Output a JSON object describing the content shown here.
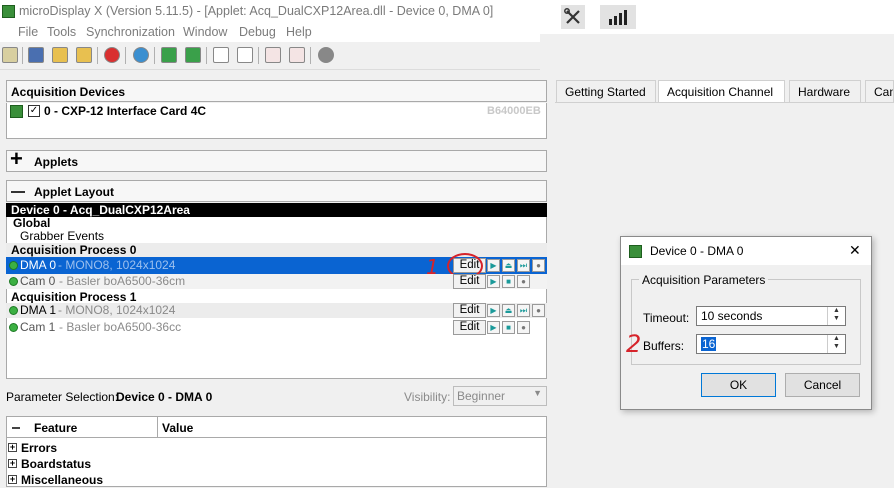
{
  "window": {
    "title": "microDisplay X (Version 5.11.5) - [Applet: Acq_DualCXP12Area.dll - Device 0, DMA 0]"
  },
  "menu": [
    "File",
    "Tools",
    "Synchronization",
    "Window",
    "Debug",
    "Help"
  ],
  "acquisition_devices": {
    "header": "Acquisition Devices",
    "device": "0 - CXP-12 Interface Card 4C",
    "serial": "B64000EB"
  },
  "applets": {
    "header": "Applets"
  },
  "applet_layout": {
    "header": "Applet Layout",
    "device_title": "Device 0 - Acq_DualCXP12Area",
    "global_label": "Global",
    "grabber_events": "Grabber Events",
    "processes": [
      {
        "label": "Acquisition Process 0",
        "dma": {
          "name": "DMA 0",
          "info": " - MONO8, 1024x1024",
          "edit": "Edit"
        },
        "cam": {
          "name": "Cam 0",
          "info": " - Basler boA6500-36cm",
          "edit": "Edit"
        }
      },
      {
        "label": "Acquisition Process 1",
        "dma": {
          "name": "DMA 1",
          "info": " - MONO8, 1024x1024",
          "edit": "Edit"
        },
        "cam": {
          "name": "Cam 1",
          "info": " - Basler boA6500-36cc",
          "edit": "Edit"
        }
      }
    ]
  },
  "parameter_selection": {
    "label": "Parameter Selection:",
    "value": "Device 0 - DMA 0",
    "visibility_label": "Visibility:",
    "visibility_value": "Beginner"
  },
  "param_table": {
    "columns": [
      "Feature",
      "Value"
    ],
    "rows": [
      "Errors",
      "Boardstatus",
      "Miscellaneous"
    ]
  },
  "tabs": [
    "Getting Started",
    "Acquisition Channel",
    "Hardware",
    "Can"
  ],
  "dialog": {
    "title": "Device 0 - DMA 0",
    "close": "✕",
    "group_label": "Acquisition Parameters",
    "timeout_label": "Timeout:",
    "timeout_value": "10 seconds",
    "buffers_label": "Buffers:",
    "buffers_value": "16",
    "ok": "OK",
    "cancel": "Cancel"
  },
  "annotations": {
    "one": "1",
    "two": "2"
  },
  "colors": {
    "selection": "#0a64d2",
    "annotation": "#d6232a",
    "status_green": "#3cb043"
  }
}
